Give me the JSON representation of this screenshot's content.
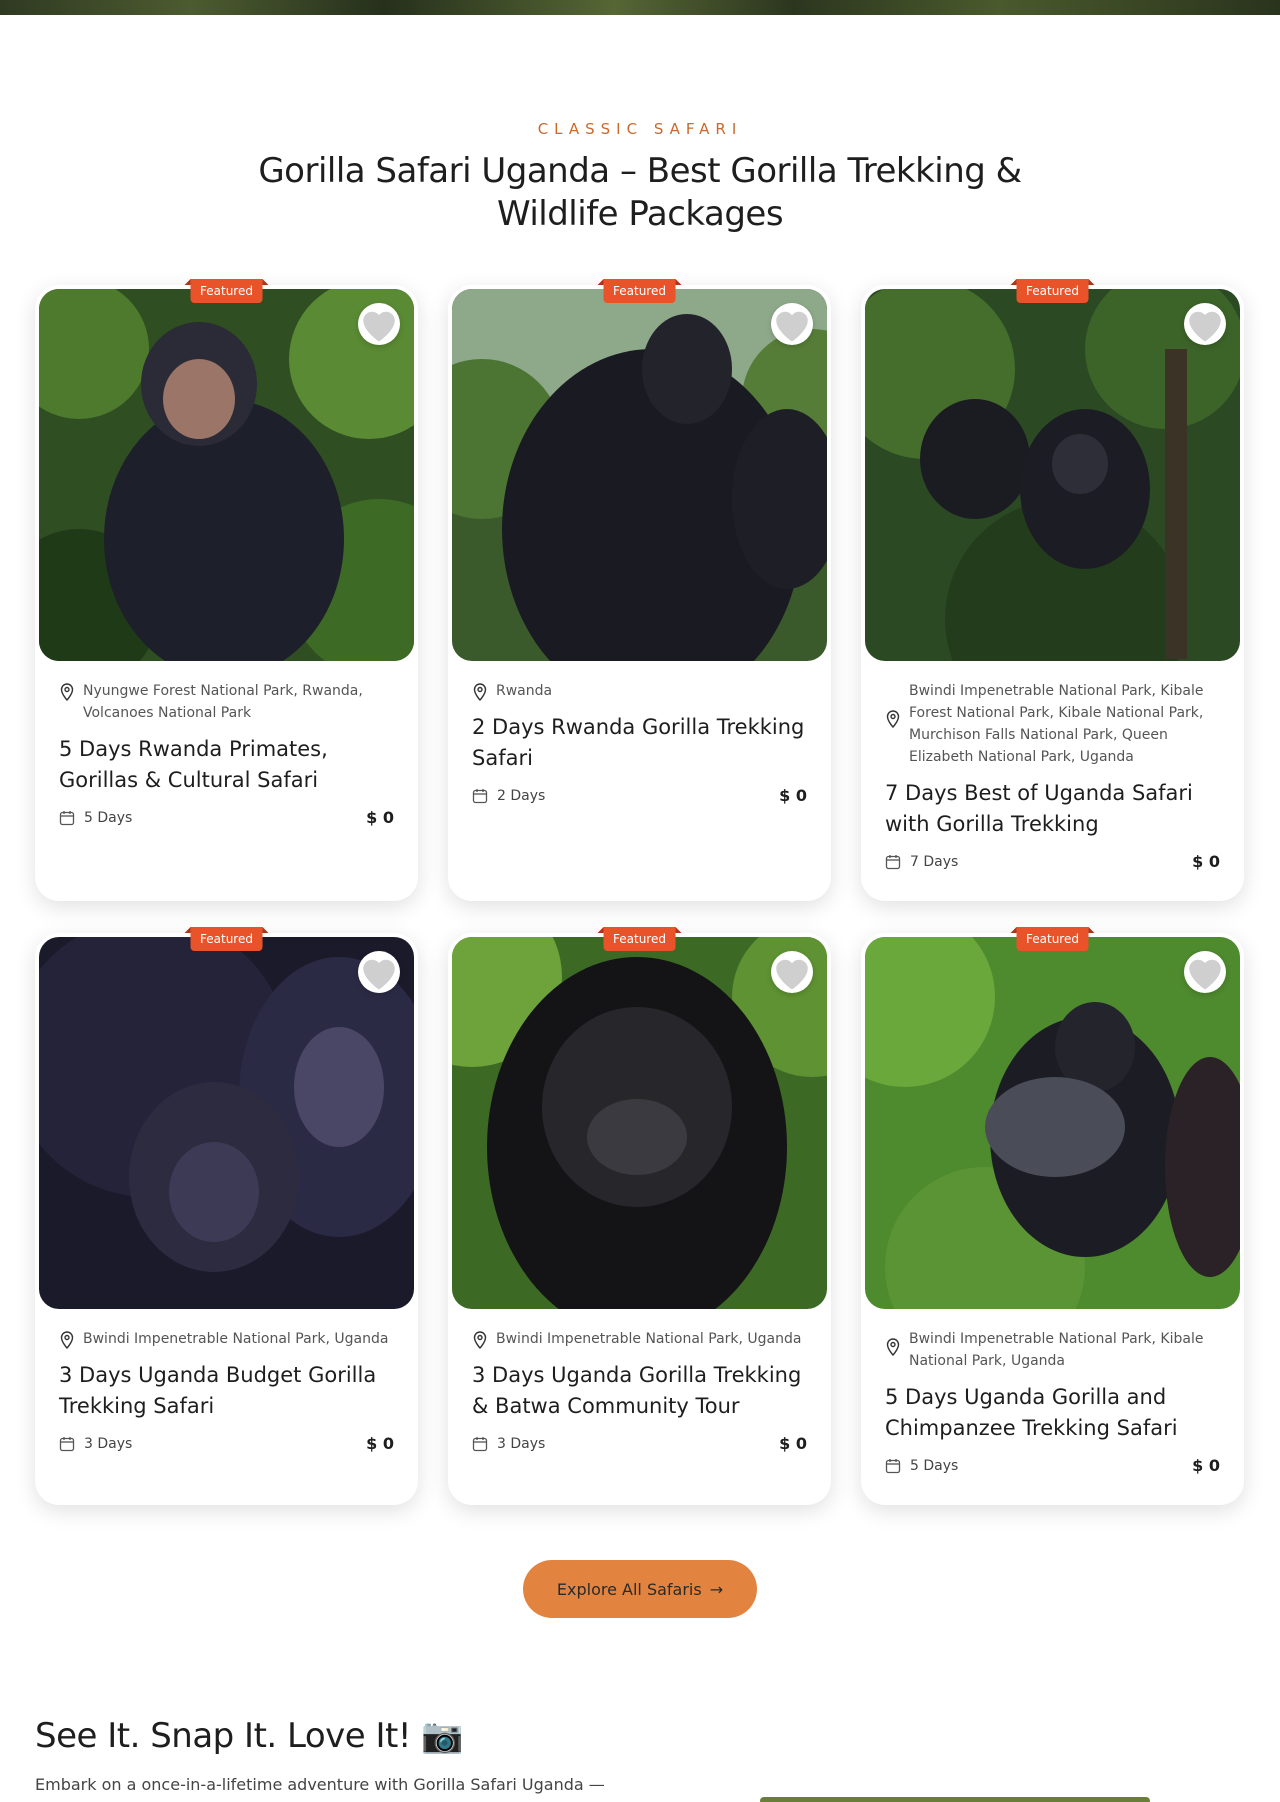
{
  "section": {
    "eyebrow": "CLASSIC SAFARI",
    "title": "Gorilla Safari Uganda – Best Gorilla Trekking & Wildlife Packages"
  },
  "badge_label": "Featured",
  "cards": [
    {
      "location": "Nyungwe Forest National Park, Rwanda, Volcanoes National Park",
      "title": "5 Days Rwanda Primates, Gorillas & Cultural Safari",
      "days": "5 Days",
      "price": "$ 0",
      "image_icon": "chimpanzee-photo"
    },
    {
      "location": "Rwanda",
      "title": "2 Days Rwanda Gorilla Trekking Safari",
      "days": "2 Days",
      "price": "$ 0",
      "image_icon": "gorilla-photo"
    },
    {
      "location": "Bwindi Impenetrable National Park, Kibale Forest National Park, Kibale National Park, Murchison Falls National Park, Queen Elizabeth National Park, Uganda",
      "title": "7 Days Best of Uganda Safari with Gorilla Trekking",
      "days": "7 Days",
      "price": "$ 0",
      "image_icon": "young-gorillas-photo"
    },
    {
      "location": "Bwindi Impenetrable National Park, Uganda",
      "title": "3 Days Uganda Budget Gorilla Trekking Safari",
      "days": "3 Days",
      "price": "$ 0",
      "image_icon": "gorilla-family-photo"
    },
    {
      "location": "Bwindi Impenetrable National Park, Uganda",
      "title": "3 Days Uganda Gorilla Trekking & Batwa Community Tour",
      "days": "3 Days",
      "price": "$ 0",
      "image_icon": "silverback-portrait-photo"
    },
    {
      "location": "Bwindi Impenetrable National Park, Kibale National Park, Uganda",
      "title": "5 Days Uganda Gorilla and Chimpanzee Trekking Safari",
      "days": "5 Days",
      "price": "$ 0",
      "image_icon": "silverback-walking-photo"
    }
  ],
  "cta": {
    "label": "Explore All Safaris",
    "arrow": "→"
  },
  "snap": {
    "title": "See It. Snap It. Love It! 📷",
    "text": "Embark on a once-in-a-lifetime adventure with Gorilla Safari Uganda —"
  },
  "colors": {
    "accent": "#e8532a",
    "button": "#e2843f",
    "eyebrow": "#c8692e"
  }
}
